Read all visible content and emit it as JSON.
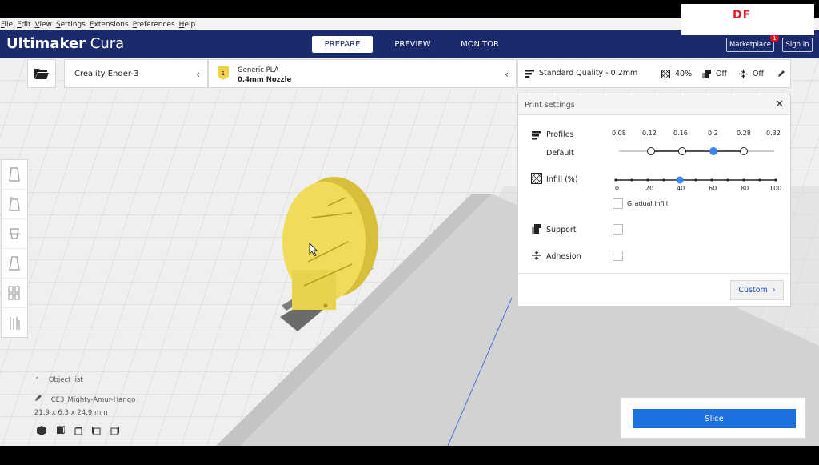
{
  "menu": [
    {
      "u": "F",
      "rest": "ile"
    },
    {
      "u": "E",
      "rest": "dit"
    },
    {
      "u": "V",
      "rest": "iew"
    },
    {
      "u": "S",
      "rest": "ettings"
    },
    {
      "u": "E",
      "rest": "xtensions"
    },
    {
      "u": "P",
      "rest": "references"
    },
    {
      "u": "H",
      "rest": "elp"
    }
  ],
  "app": {
    "brand": "Ultimaker",
    "product": "Cura"
  },
  "stages": [
    "PREPARE",
    "PREVIEW",
    "MONITOR"
  ],
  "active_stage": "PREPARE",
  "header": {
    "marketplace": "Marketplace",
    "marketplace_badge": "1",
    "sign_in": "Sign in"
  },
  "watermark": "DF",
  "printer": {
    "name": "Creality Ender-3"
  },
  "material": {
    "extruder": "1",
    "name": "Generic PLA",
    "nozzle": "0.4mm Nozzle",
    "badge_color": "#f1d14a"
  },
  "quality": {
    "profile": "Standard Quality - 0.2mm",
    "infill": "40%",
    "support": "Off",
    "adhesion": "Off"
  },
  "panel": {
    "title": "Print settings",
    "profiles_label": "Profiles",
    "profiles_sub": "Default",
    "profile_ticks": [
      "0.08",
      "0.12",
      "0.16",
      "0.2",
      "0.28",
      "0.32"
    ],
    "profile_selected": "0.2",
    "infill_label": "Infill (%)",
    "infill_ticks": [
      "0",
      "20",
      "40",
      "60",
      "80",
      "100"
    ],
    "infill_value": 40,
    "gradual_label": "Gradual infill",
    "gradual_checked": false,
    "support_label": "Support",
    "support_checked": false,
    "adhesion_label": "Adhesion",
    "adhesion_checked": false,
    "custom_label": "Custom"
  },
  "object_list": {
    "title": "Object list",
    "name": "CE3_Mighty-Amur-Hango",
    "dims": "21.9 x 6.3 x 24.9 mm"
  },
  "slice_label": "Slice",
  "colors": {
    "header": "#1b2a6c",
    "accent": "#1e6fe0",
    "model": "#f0db5a",
    "slider_active": "#3c86f0"
  }
}
